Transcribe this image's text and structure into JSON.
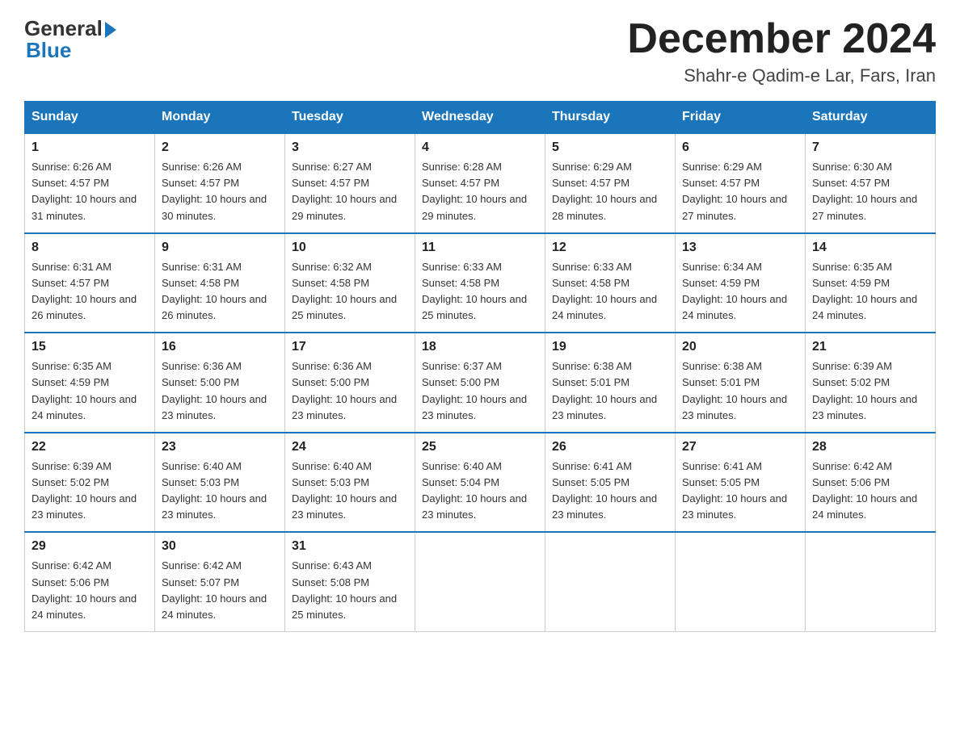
{
  "logo": {
    "general": "General",
    "blue": "Blue"
  },
  "header": {
    "month_title": "December 2024",
    "subtitle": "Shahr-e Qadim-e Lar, Fars, Iran"
  },
  "days_of_week": [
    "Sunday",
    "Monday",
    "Tuesday",
    "Wednesday",
    "Thursday",
    "Friday",
    "Saturday"
  ],
  "weeks": [
    [
      {
        "num": "1",
        "sunrise": "6:26 AM",
        "sunset": "4:57 PM",
        "daylight": "10 hours and 31 minutes."
      },
      {
        "num": "2",
        "sunrise": "6:26 AM",
        "sunset": "4:57 PM",
        "daylight": "10 hours and 30 minutes."
      },
      {
        "num": "3",
        "sunrise": "6:27 AM",
        "sunset": "4:57 PM",
        "daylight": "10 hours and 29 minutes."
      },
      {
        "num": "4",
        "sunrise": "6:28 AM",
        "sunset": "4:57 PM",
        "daylight": "10 hours and 29 minutes."
      },
      {
        "num": "5",
        "sunrise": "6:29 AM",
        "sunset": "4:57 PM",
        "daylight": "10 hours and 28 minutes."
      },
      {
        "num": "6",
        "sunrise": "6:29 AM",
        "sunset": "4:57 PM",
        "daylight": "10 hours and 27 minutes."
      },
      {
        "num": "7",
        "sunrise": "6:30 AM",
        "sunset": "4:57 PM",
        "daylight": "10 hours and 27 minutes."
      }
    ],
    [
      {
        "num": "8",
        "sunrise": "6:31 AM",
        "sunset": "4:57 PM",
        "daylight": "10 hours and 26 minutes."
      },
      {
        "num": "9",
        "sunrise": "6:31 AM",
        "sunset": "4:58 PM",
        "daylight": "10 hours and 26 minutes."
      },
      {
        "num": "10",
        "sunrise": "6:32 AM",
        "sunset": "4:58 PM",
        "daylight": "10 hours and 25 minutes."
      },
      {
        "num": "11",
        "sunrise": "6:33 AM",
        "sunset": "4:58 PM",
        "daylight": "10 hours and 25 minutes."
      },
      {
        "num": "12",
        "sunrise": "6:33 AM",
        "sunset": "4:58 PM",
        "daylight": "10 hours and 24 minutes."
      },
      {
        "num": "13",
        "sunrise": "6:34 AM",
        "sunset": "4:59 PM",
        "daylight": "10 hours and 24 minutes."
      },
      {
        "num": "14",
        "sunrise": "6:35 AM",
        "sunset": "4:59 PM",
        "daylight": "10 hours and 24 minutes."
      }
    ],
    [
      {
        "num": "15",
        "sunrise": "6:35 AM",
        "sunset": "4:59 PM",
        "daylight": "10 hours and 24 minutes."
      },
      {
        "num": "16",
        "sunrise": "6:36 AM",
        "sunset": "5:00 PM",
        "daylight": "10 hours and 23 minutes."
      },
      {
        "num": "17",
        "sunrise": "6:36 AM",
        "sunset": "5:00 PM",
        "daylight": "10 hours and 23 minutes."
      },
      {
        "num": "18",
        "sunrise": "6:37 AM",
        "sunset": "5:00 PM",
        "daylight": "10 hours and 23 minutes."
      },
      {
        "num": "19",
        "sunrise": "6:38 AM",
        "sunset": "5:01 PM",
        "daylight": "10 hours and 23 minutes."
      },
      {
        "num": "20",
        "sunrise": "6:38 AM",
        "sunset": "5:01 PM",
        "daylight": "10 hours and 23 minutes."
      },
      {
        "num": "21",
        "sunrise": "6:39 AM",
        "sunset": "5:02 PM",
        "daylight": "10 hours and 23 minutes."
      }
    ],
    [
      {
        "num": "22",
        "sunrise": "6:39 AM",
        "sunset": "5:02 PM",
        "daylight": "10 hours and 23 minutes."
      },
      {
        "num": "23",
        "sunrise": "6:40 AM",
        "sunset": "5:03 PM",
        "daylight": "10 hours and 23 minutes."
      },
      {
        "num": "24",
        "sunrise": "6:40 AM",
        "sunset": "5:03 PM",
        "daylight": "10 hours and 23 minutes."
      },
      {
        "num": "25",
        "sunrise": "6:40 AM",
        "sunset": "5:04 PM",
        "daylight": "10 hours and 23 minutes."
      },
      {
        "num": "26",
        "sunrise": "6:41 AM",
        "sunset": "5:05 PM",
        "daylight": "10 hours and 23 minutes."
      },
      {
        "num": "27",
        "sunrise": "6:41 AM",
        "sunset": "5:05 PM",
        "daylight": "10 hours and 23 minutes."
      },
      {
        "num": "28",
        "sunrise": "6:42 AM",
        "sunset": "5:06 PM",
        "daylight": "10 hours and 24 minutes."
      }
    ],
    [
      {
        "num": "29",
        "sunrise": "6:42 AM",
        "sunset": "5:06 PM",
        "daylight": "10 hours and 24 minutes."
      },
      {
        "num": "30",
        "sunrise": "6:42 AM",
        "sunset": "5:07 PM",
        "daylight": "10 hours and 24 minutes."
      },
      {
        "num": "31",
        "sunrise": "6:43 AM",
        "sunset": "5:08 PM",
        "daylight": "10 hours and 25 minutes."
      },
      null,
      null,
      null,
      null
    ]
  ]
}
